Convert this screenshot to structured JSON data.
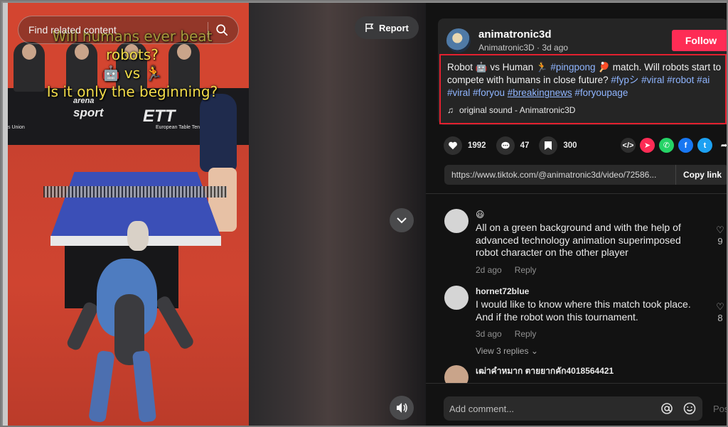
{
  "search": {
    "placeholder": "Find related content"
  },
  "video": {
    "caption_lines": [
      "Will humans ever beat",
      "robots?",
      "🤖 vs 🏃",
      "Is it only the beginning?"
    ],
    "ad_board_texts": [
      "arena",
      "sport",
      "ETT",
      "European Table Tennis",
      "s Union"
    ],
    "report_label": "Report"
  },
  "author": {
    "username": "animatronic3d",
    "display": "Animatronic3D",
    "time": "3d ago",
    "follow_label": "Follow"
  },
  "description": {
    "part1": "Robot 🤖 vs Human 🏃 ",
    "tag_pingpong": "#pingpong",
    "part2": " 🏓 match. Will robots start to compete with humans in close future? ",
    "tags1": "#fypシ #viral #robot #ai #viral #foryou ",
    "tag_breaking": "#breakingnews",
    "tags2": " #foryoupage",
    "sound": "original sound - Animatronic3D"
  },
  "stats": {
    "likes": "1992",
    "comments": "47",
    "saves": "300"
  },
  "share": {
    "link": "https://www.tiktok.com/@animatronic3d/video/72586...",
    "copy_label": "Copy link",
    "icons": [
      "embed-icon",
      "send-icon",
      "whatsapp-icon",
      "facebook-icon",
      "twitter-icon",
      "share-arrow-icon"
    ]
  },
  "comments": [
    {
      "user": "😃",
      "text": "All on a green background and with the help of advanced technology animation superimposed robot character on the other player",
      "time": "2d ago",
      "reply": "Reply",
      "likes": "9"
    },
    {
      "user": "hornet72blue",
      "text": "I would like to know where this match took place. And if the robot won this tournament.",
      "time": "3d ago",
      "reply": "Reply",
      "likes": "8",
      "view_replies": "View 3 replies"
    },
    {
      "user": "เฒ่าคำหมาก ตายยากคัก4018564421",
      "text": ""
    }
  ],
  "comment_bar": {
    "placeholder": "Add comment...",
    "post_label": "Post"
  },
  "colors": {
    "accent": "#fe2c55",
    "highlight": "#e3202f",
    "hashtag": "#8fb5ff"
  }
}
